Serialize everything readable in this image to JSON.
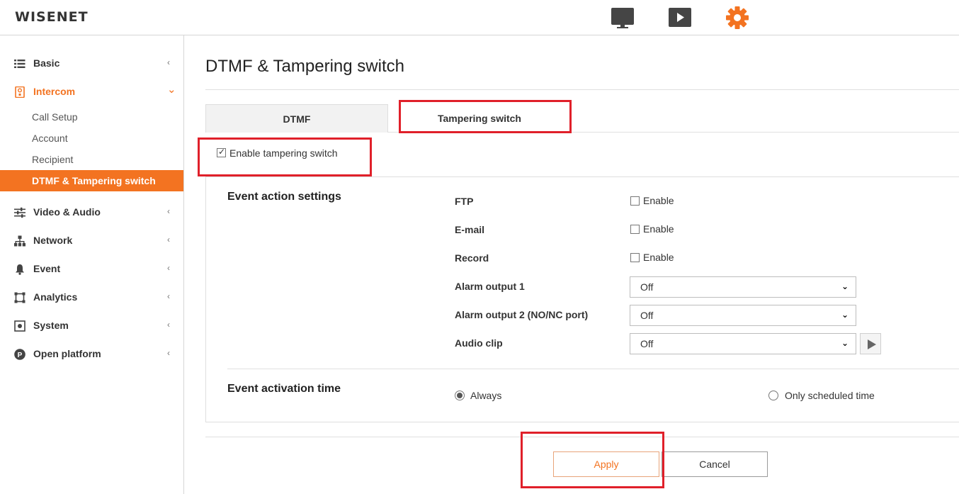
{
  "app": {
    "logo": "WISENET"
  },
  "header_icons": [
    "monitor-icon",
    "play-icon",
    "gear-icon"
  ],
  "colors": {
    "accent": "#f37321",
    "highlight_box": "#e0202a"
  },
  "sidebar": {
    "items": [
      {
        "label": "Basic",
        "icon": "list-icon",
        "chevron": "‹"
      },
      {
        "label": "Intercom",
        "icon": "intercom-icon",
        "chevron": "⌄",
        "expanded": true,
        "children": [
          "Call Setup",
          "Account",
          "Recipient",
          "DTMF & Tampering switch"
        ],
        "active_child": "DTMF & Tampering switch"
      },
      {
        "label": "Video & Audio",
        "icon": "sliders-icon",
        "chevron": "‹"
      },
      {
        "label": "Network",
        "icon": "network-icon",
        "chevron": "‹"
      },
      {
        "label": "Event",
        "icon": "bell-icon",
        "chevron": "‹"
      },
      {
        "label": "Analytics",
        "icon": "analytics-icon",
        "chevron": "‹"
      },
      {
        "label": "System",
        "icon": "system-icon",
        "chevron": "‹"
      },
      {
        "label": "Open platform",
        "icon": "open-platform-icon",
        "chevron": "‹"
      }
    ]
  },
  "main": {
    "title": "DTMF & Tampering switch",
    "tabs": [
      {
        "label": "DTMF",
        "active": false
      },
      {
        "label": "Tampering switch",
        "active": true
      }
    ],
    "enable_tampering": {
      "label": "Enable tampering switch",
      "checked": true
    },
    "event_action": {
      "title": "Event action settings",
      "ftp": {
        "label": "FTP",
        "option": "Enable",
        "checked": false
      },
      "email": {
        "label": "E-mail",
        "option": "Enable",
        "checked": false
      },
      "record": {
        "label": "Record",
        "option": "Enable",
        "checked": false
      },
      "alarm1": {
        "label": "Alarm output 1",
        "value": "Off"
      },
      "alarm2": {
        "label": "Alarm output 2 (NO/NC port)",
        "value": "Off"
      },
      "audio_clip": {
        "label": "Audio clip",
        "value": "Off"
      }
    },
    "activation": {
      "title": "Event activation time",
      "always": "Always",
      "scheduled": "Only scheduled time",
      "selected": "Always"
    },
    "buttons": {
      "apply": "Apply",
      "cancel": "Cancel"
    }
  }
}
